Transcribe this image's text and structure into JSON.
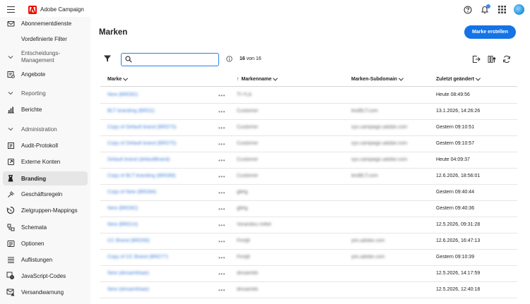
{
  "app": {
    "title": "Adobe Campaign"
  },
  "sidebar": {
    "items": [
      {
        "label": "Abonnementdienste",
        "icon": "mail-icon",
        "type": "item"
      },
      {
        "label": "Vordefinierte Filter",
        "icon": "filter-icon",
        "type": "item"
      },
      {
        "label": "Entscheidungs-",
        "label2": "Management",
        "icon": "chevron-down-icon",
        "type": "section"
      },
      {
        "label": "Angebote",
        "icon": "offer-icon",
        "type": "item"
      },
      {
        "label": "Reporting",
        "icon": "chevron-down-icon",
        "type": "section"
      },
      {
        "label": "Berichte",
        "icon": "chart-icon",
        "type": "item"
      },
      {
        "label": "Administration",
        "icon": "chevron-down-icon",
        "type": "section"
      },
      {
        "label": "Audit-Protokoll",
        "icon": "audit-icon",
        "type": "item"
      },
      {
        "label": "Externe Konten",
        "icon": "external-icon",
        "type": "item"
      },
      {
        "label": "Branding",
        "icon": "branding-icon",
        "type": "item",
        "active": true
      },
      {
        "label": "Geschäftsregeln",
        "icon": "rules-icon",
        "type": "item"
      },
      {
        "label": "Zielgruppen-Mappings",
        "icon": "mapping-icon",
        "type": "item"
      },
      {
        "label": "Schemata",
        "icon": "schema-icon",
        "type": "item"
      },
      {
        "label": "Optionen",
        "icon": "options-icon",
        "type": "item"
      },
      {
        "label": "Auflistungen",
        "icon": "list-icon",
        "type": "item"
      },
      {
        "label": "JavaScript-Codes",
        "icon": "code-icon",
        "type": "item"
      },
      {
        "label": "Versandwarnung",
        "icon": "warning-mail-icon",
        "type": "item"
      }
    ]
  },
  "main": {
    "title": "Marken",
    "create_button": "Marke erstellen",
    "search": {
      "value": "",
      "placeholder": ""
    },
    "count": {
      "value": "16",
      "suffix": "von 16"
    },
    "table": {
      "columns": [
        "Marke",
        "Markenname",
        "Marken-Subdomain",
        "Zuletzt geändert"
      ],
      "rows": [
        {
          "brand": "New (BRD92)",
          "name": "TI-YLb",
          "subdomain": "",
          "modified": "Heute 08:49:56"
        },
        {
          "brand": "BLT branding (BRD2)",
          "name": "Customer",
          "subdomain": "testBLT.com",
          "modified": "13.1.2026, 14:26:26"
        },
        {
          "brand": "Copy of Default brand (BRD73)",
          "name": "Customer",
          "subdomain": "sys.campaign.adobe.com",
          "modified": "Gestern 09:10:51"
        },
        {
          "brand": "Copy of Default brand (BRD75)",
          "name": "Customer",
          "subdomain": "sys.campaign.adobe.com",
          "modified": "Gestern 09:10:57"
        },
        {
          "brand": "Default brand (defaultBrand)",
          "name": "Customer",
          "subdomain": "sys.campaign.adobe.com",
          "modified": "Heute 04:09:37"
        },
        {
          "brand": "Copy of BLT branding (BRD89)",
          "name": "Customer",
          "subdomain": "testBLT.com",
          "modified": "12.6.2026, 18:56:01"
        },
        {
          "brand": "Copy of New (BRD84)",
          "name": "gbhg",
          "subdomain": "",
          "modified": "Gestern 09:40:44"
        },
        {
          "brand": "New (BRD82)",
          "name": "gbhg",
          "subdomain": "",
          "modified": "Gestern 09:40:36"
        },
        {
          "brand": "New (BRD14)",
          "name": "Vorandou mittel",
          "subdomain": "",
          "modified": "12.5.2026, 09:31:28"
        },
        {
          "brand": "CC Brand (BRD58)",
          "name": "Firstjlt",
          "subdomain": "yes.adobe.com",
          "modified": "12.6.2026, 16:47:13"
        },
        {
          "brand": "Copy of CC Brand (BRD77)",
          "name": "Firstjlt",
          "subdomain": "yes.adobe.com",
          "modified": "Gestern 09:10:39"
        },
        {
          "brand": "New (dinsamthaar)",
          "name": "dinsamkb",
          "subdomain": "",
          "modified": "12.5.2026, 14:17:59"
        },
        {
          "brand": "New (dinsamthaar)",
          "name": "dinsamkb",
          "subdomain": "",
          "modified": "12.5.2026, 12:40:18"
        }
      ]
    }
  }
}
